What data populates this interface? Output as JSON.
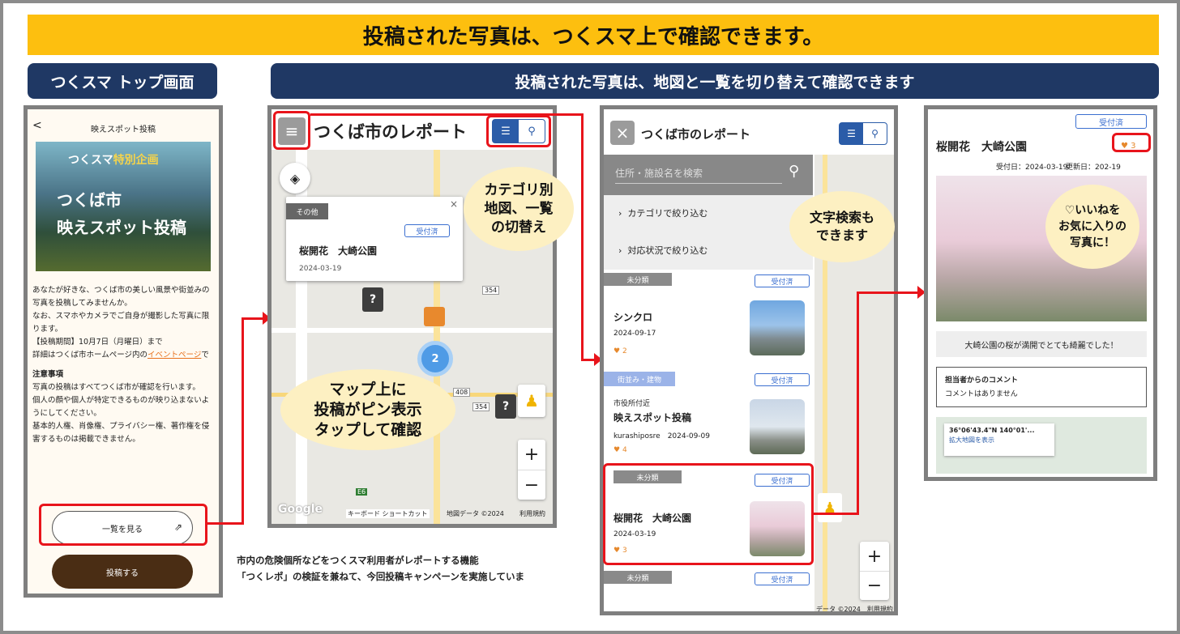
{
  "banner": "投稿された写真は、つくスマ上で確認できます。",
  "label_left": "つくスマ トップ画面",
  "label_right": "投稿された写真は、地図と一覧を切り替えて確認できます",
  "phone1": {
    "back": "<",
    "title": "映えスポット投稿",
    "hero_top": "つくスマ",
    "hero_special": "特別企画",
    "hero_line1": "つくば市",
    "hero_line2": "映えスポット投稿",
    "para1": "あなたが好きな、つくば市の美しい風景や街並みの写真を投稿してみませんか。",
    "para2": "なお、スマホやカメラでご自身が撮影した写真に限ります。",
    "period": "【投稿期間】10月7日（月曜日）まで",
    "detail_prefix": "詳細はつくば市ホームページ内の",
    "detail_link": "イベントページ",
    "detail_suffix": "で",
    "notice_head": "注意事項",
    "notice1": "写真の投稿はすべてつくば市が確認を行います。",
    "notice2": "個人の顔や個人が特定できるものが映り込まないようにしてください。",
    "notice3": "基本的人権、肖像権、プライバシー権、著作権を侵害するものは掲載できません。",
    "list_button": "一覧を見る",
    "post_button": "投稿する"
  },
  "phone2": {
    "title": "つくば市のレポート",
    "popup_tag": "その他",
    "popup_status": "受付済",
    "popup_title": "桜開花　大崎公園",
    "popup_date": "2024-03-19",
    "cluster": "2",
    "road_354": "354",
    "road_408": "408",
    "road_e6": "E6",
    "google": "Google",
    "footer_keys": "キーボード ショートカット",
    "footer_data": "地図データ ©2024",
    "footer_terms": "利用規約",
    "zoom_in": "+",
    "zoom_out": "−"
  },
  "bubble_category": "カテゴリ別\n地図、一覧\nの切替え",
  "bubble_pin": "マップ上に\n投稿がピン表示\nタップして確認",
  "bubble_search": "文字検索も\nできます",
  "bubble_like": "♡いいねを\nお気に入りの\n写真に！",
  "caption1": "市内の危険個所などをつくスマ利用者がレポートする機能",
  "caption2": "「つくレポ」の検証を兼ねて、今回投稿キャンペーンを実施していま",
  "phone3": {
    "title": "つくば市のレポート",
    "search_placeholder": "住所・施設名を検索",
    "filter_category": "カテゴリで絞り込む",
    "filter_status": "対応状況で絞り込む",
    "items": [
      {
        "tag": "未分類",
        "status": "受付済",
        "place": "",
        "title": "シンクロ",
        "meta": "2024-09-17",
        "likes": "2"
      },
      {
        "tag": "街並み・建物",
        "status": "受付済",
        "place": "市役所付近",
        "title": "映えスポット投稿",
        "meta": "kurashiposre　2024-09-09",
        "likes": "4"
      },
      {
        "tag": "未分類",
        "status": "受付済",
        "place": "",
        "title": "桜開花　大崎公園",
        "meta": "2024-03-19",
        "likes": "3"
      },
      {
        "tag": "未分類",
        "status": "受付済",
        "place": "",
        "title": "",
        "meta": "",
        "likes": ""
      }
    ],
    "map_footer": "データ ©2024　利用規約",
    "zoom_in": "+",
    "zoom_out": "−"
  },
  "phone4": {
    "status": "受付済",
    "title": "桜開花　大崎公園",
    "likes": "3",
    "received": "受付日：2024-03-19",
    "updated": "更新日：202",
    "updated_tail": "-19",
    "caption": "大崎公園の桜が満開でとても綺麗でした！",
    "comment_head": "担当者からのコメント",
    "comment_body": "コメントはありません",
    "coords": "36°06'43.4\"N 140°01'...",
    "map_link": "拡大地図を表示"
  }
}
